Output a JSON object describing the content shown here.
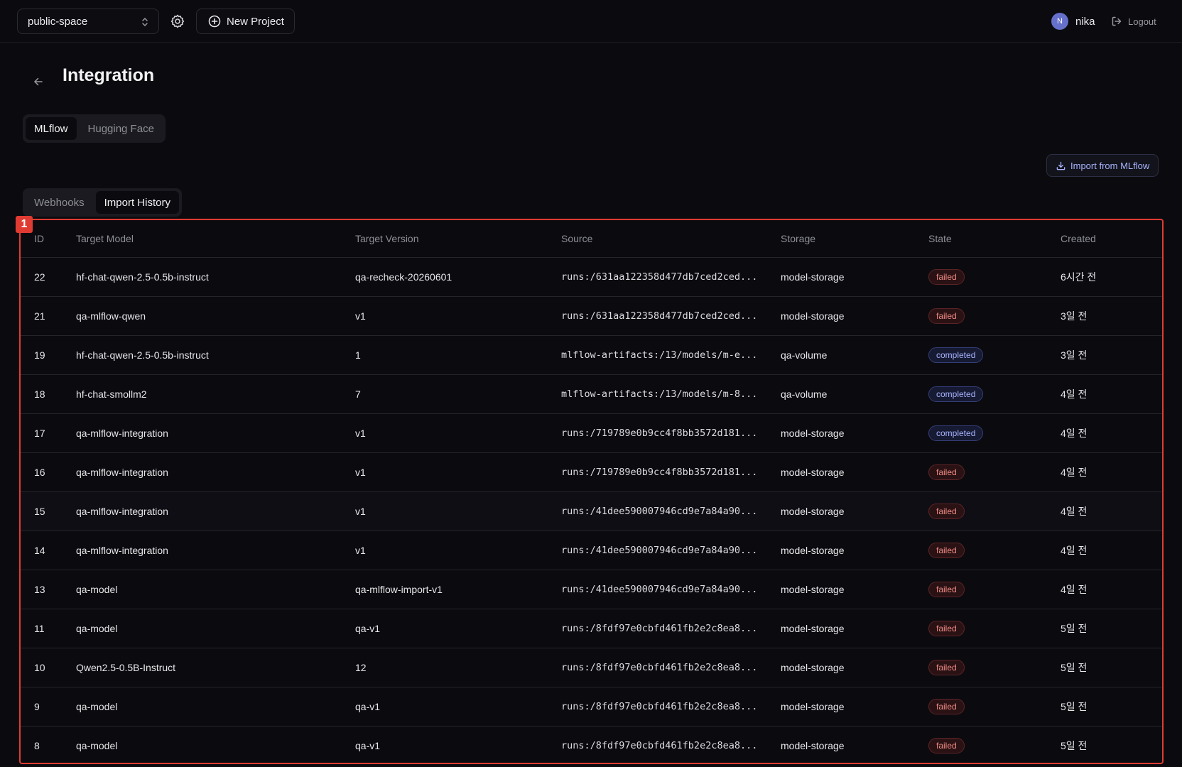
{
  "topbar": {
    "workspace": "public-space",
    "new_project_label": "New Project",
    "user_initial": "N",
    "user_name": "nika",
    "logout_label": "Logout"
  },
  "page": {
    "title": "Integration"
  },
  "provider_tabs": [
    "MLflow",
    "Hugging Face"
  ],
  "provider_active": 0,
  "view_tabs": [
    "Webhooks",
    "Import History"
  ],
  "view_active": 1,
  "import_button_label": "Import from MLflow",
  "marker_label": "1",
  "colors": {
    "accent": "#a9b4ff",
    "failed": "#f08a85",
    "highlight": "#e03b33"
  },
  "table": {
    "headers": [
      "ID",
      "Target Model",
      "Target Version",
      "Source",
      "Storage",
      "State",
      "Created"
    ],
    "rows": [
      {
        "id": "22",
        "model": "hf-chat-qwen-2.5-0.5b-instruct",
        "version": "qa-recheck-20260601",
        "source": "runs:/631aa122358d477db7ced2ced...",
        "storage": "model-storage",
        "state": "failed",
        "created": "6시간 전"
      },
      {
        "id": "21",
        "model": "qa-mlflow-qwen",
        "version": "v1",
        "source": "runs:/631aa122358d477db7ced2ced...",
        "storage": "model-storage",
        "state": "failed",
        "created": "3일 전"
      },
      {
        "id": "19",
        "model": "hf-chat-qwen-2.5-0.5b-instruct",
        "version": "1",
        "source": "mlflow-artifacts:/13/models/m-e...",
        "storage": "qa-volume",
        "state": "completed",
        "created": "3일 전"
      },
      {
        "id": "18",
        "model": "hf-chat-smollm2",
        "version": "7",
        "source": "mlflow-artifacts:/13/models/m-8...",
        "storage": "qa-volume",
        "state": "completed",
        "created": "4일 전"
      },
      {
        "id": "17",
        "model": "qa-mlflow-integration",
        "version": "v1",
        "source": "runs:/719789e0b9cc4f8bb3572d181...",
        "storage": "model-storage",
        "state": "completed",
        "created": "4일 전"
      },
      {
        "id": "16",
        "model": "qa-mlflow-integration",
        "version": "v1",
        "source": "runs:/719789e0b9cc4f8bb3572d181...",
        "storage": "model-storage",
        "state": "failed",
        "created": "4일 전"
      },
      {
        "id": "15",
        "model": "qa-mlflow-integration",
        "version": "v1",
        "source": "runs:/41dee590007946cd9e7a84a90...",
        "storage": "model-storage",
        "state": "failed",
        "created": "4일 전"
      },
      {
        "id": "14",
        "model": "qa-mlflow-integration",
        "version": "v1",
        "source": "runs:/41dee590007946cd9e7a84a90...",
        "storage": "model-storage",
        "state": "failed",
        "created": "4일 전"
      },
      {
        "id": "13",
        "model": "qa-model",
        "version": "qa-mlflow-import-v1",
        "source": "runs:/41dee590007946cd9e7a84a90...",
        "storage": "model-storage",
        "state": "failed",
        "created": "4일 전"
      },
      {
        "id": "11",
        "model": "qa-model",
        "version": "qa-v1",
        "source": "runs:/8fdf97e0cbfd461fb2e2c8ea8...",
        "storage": "model-storage",
        "state": "failed",
        "created": "5일 전"
      },
      {
        "id": "10",
        "model": "Qwen2.5-0.5B-Instruct",
        "version": "12",
        "source": "runs:/8fdf97e0cbfd461fb2e2c8ea8...",
        "storage": "model-storage",
        "state": "failed",
        "created": "5일 전"
      },
      {
        "id": "9",
        "model": "qa-model",
        "version": "qa-v1",
        "source": "runs:/8fdf97e0cbfd461fb2e2c8ea8...",
        "storage": "model-storage",
        "state": "failed",
        "created": "5일 전"
      },
      {
        "id": "8",
        "model": "qa-model",
        "version": "qa-v1",
        "source": "runs:/8fdf97e0cbfd461fb2e2c8ea8...",
        "storage": "model-storage",
        "state": "failed",
        "created": "5일 전"
      }
    ]
  }
}
